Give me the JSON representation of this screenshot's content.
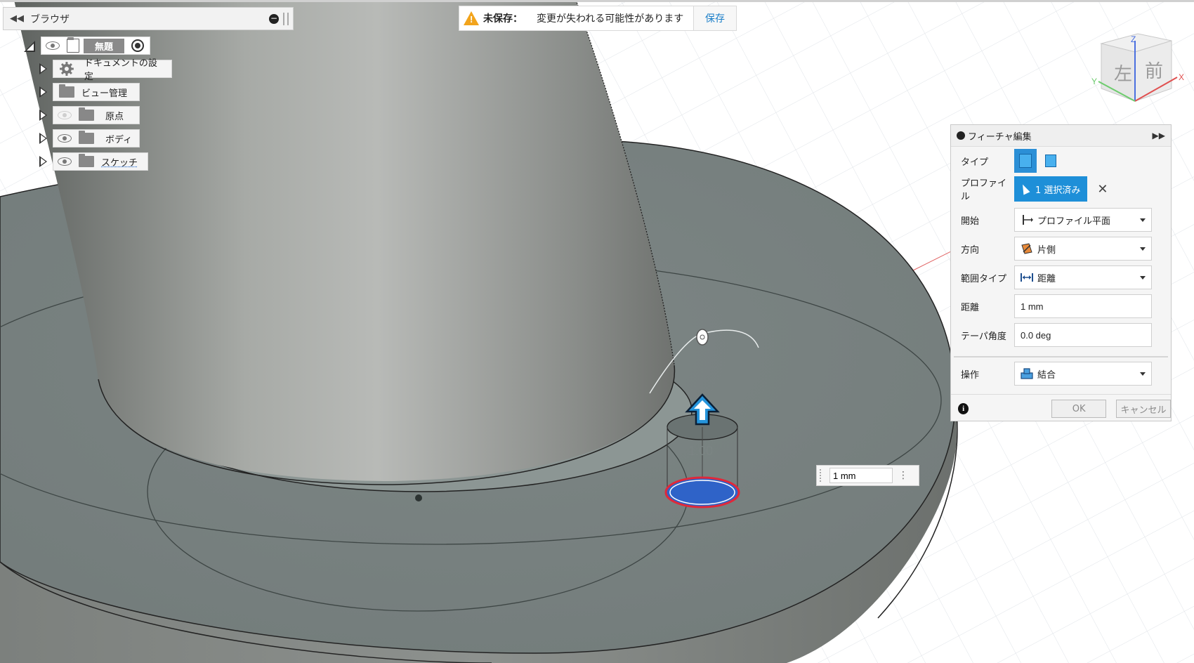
{
  "browser": {
    "title": "ブラウザ",
    "root_label": "無題",
    "items": [
      {
        "label": "ドキュメントの設定"
      },
      {
        "label": "ビュー管理"
      },
      {
        "label": "原点"
      },
      {
        "label": "ボディ"
      },
      {
        "label": "スケッチ"
      }
    ]
  },
  "unsaved": {
    "label": "未保存：",
    "message": "変更が失われる可能性があります",
    "save_label": "保存"
  },
  "viewcube": {
    "left": "左",
    "front": "前",
    "axis_x": "X",
    "axis_y": "Y",
    "axis_z": "Z"
  },
  "feature_panel": {
    "title": "フィーチャ編集",
    "type_label": "タイプ",
    "profile_label": "プロファイル",
    "profile_value": "1 選択済み",
    "start_label": "開始",
    "start_value": "プロファイル平面",
    "direction_label": "方向",
    "direction_value": "片側",
    "extent_label": "範囲タイプ",
    "extent_value": "距離",
    "distance_label": "距離",
    "distance_value": "1 mm",
    "taper_label": "テーパ角度",
    "taper_value": "0.0 deg",
    "operation_label": "操作",
    "operation_value": "結合",
    "ok_label": "OK",
    "cancel_label": "キャンセル"
  },
  "canvas": {
    "dimension_label": "1.00",
    "distance_input": "1 mm"
  },
  "colors": {
    "accent": "#1e8fd8",
    "warning": "#f2a41c",
    "profile_fill": "#2f63c8",
    "profile_edge": "#e0283a"
  }
}
